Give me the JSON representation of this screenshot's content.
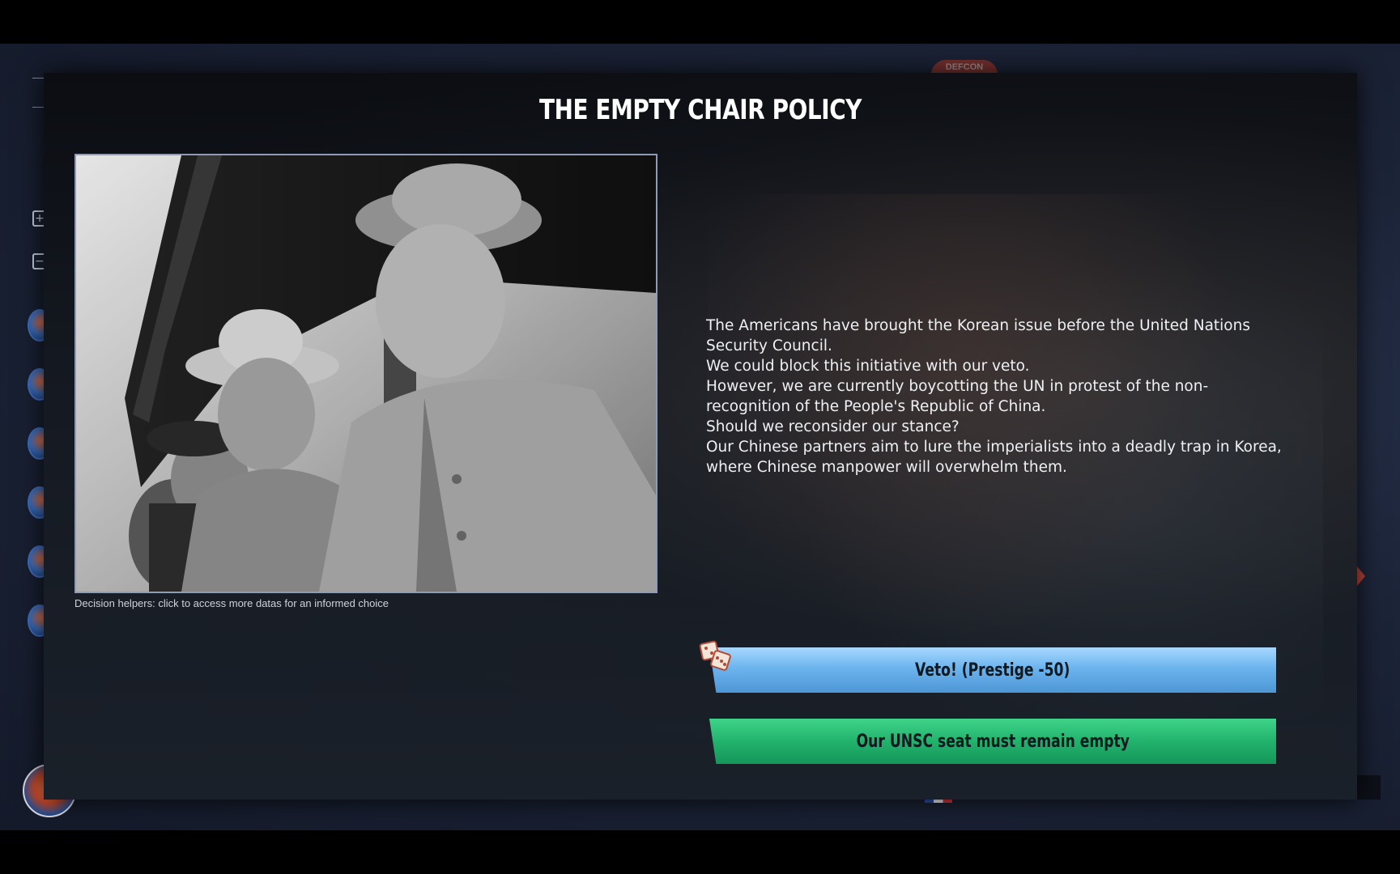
{
  "event": {
    "title": "THE EMPTY CHAIR POLICY",
    "caption": "Decision helpers: click to access more datas for an informed choice",
    "paragraphs": [
      "The Americans have brought the Korean issue before the United Nations Security Council.",
      "We could block this initiative with our veto.",
      "However, we are currently boycotting the UN in protest of the non-recognition of the People's Republic of China.",
      "Should we reconsider our stance?",
      "Our Chinese partners aim to lure the imperialists into a deadly trap in Korea, where Chinese manpower will overwhelm them."
    ]
  },
  "choices": {
    "veto_label": "Veto! (Prestige -50)",
    "empty_label": "Our UNSC seat must remain empty"
  },
  "hud": {
    "defcon_label": "DEFCON"
  },
  "colors": {
    "veto_button": "#6cb4ee",
    "empty_button": "#22b36c",
    "title_text": "#ffffff",
    "modal_bg": "#11151c"
  },
  "icons": {
    "dice": "dice-icon",
    "zoom_in": "plus-icon",
    "zoom_out": "minus-icon"
  }
}
